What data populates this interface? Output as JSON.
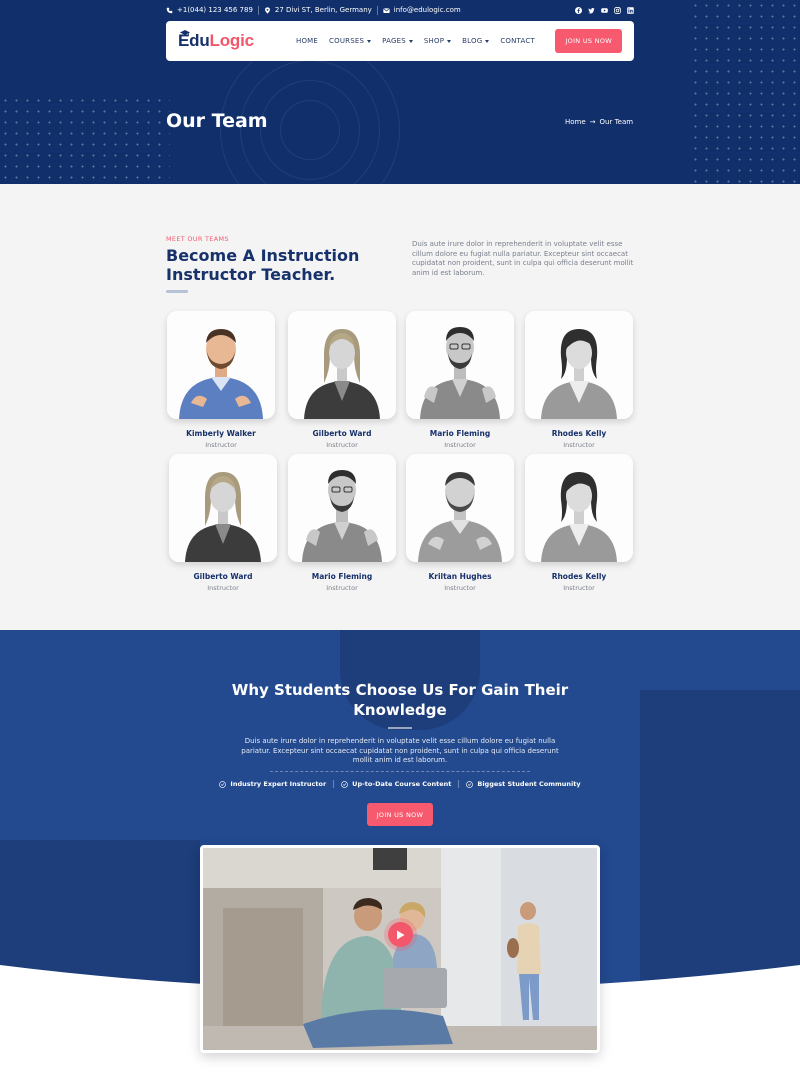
{
  "topbar": {
    "phone": "+1(044) 123 456 789",
    "address": "27 Divi ST, Berlin, Germany",
    "email": "info@edulogic.com",
    "socials": [
      "facebook-icon",
      "twitter-icon",
      "youtube-icon",
      "instagram-icon",
      "linkedin-icon"
    ]
  },
  "nav": {
    "logo_first": "Edu",
    "logo_rest": "Logic",
    "items": [
      {
        "label": "HOME",
        "dropdown": false
      },
      {
        "label": "COURSES",
        "dropdown": true
      },
      {
        "label": "PAGES",
        "dropdown": true
      },
      {
        "label": "SHOP",
        "dropdown": true
      },
      {
        "label": "BLOG",
        "dropdown": true
      },
      {
        "label": "CONTACT",
        "dropdown": false
      }
    ],
    "join_button": "JOIN US NOW"
  },
  "hero": {
    "title": "Our Team",
    "breadcrumb_home": "Home",
    "breadcrumb_arrow": "→",
    "breadcrumb_current": "Our Team"
  },
  "team": {
    "kicker": "MEET OUR TEAMS",
    "heading": "Become A Instruction Instructor Teacher.",
    "description": "Duis aute irure dolor in reprehenderit in voluptate velit esse cillum dolore eu fugiat nulla pariatur. Excepteur sint occaecat cupidatat non proident, sunt in culpa qui officia deserunt mollit anim id est laborum.",
    "members": [
      {
        "name": "Kimberly Walker",
        "role": "Instructor"
      },
      {
        "name": "Gilberto Ward",
        "role": "Instructor"
      },
      {
        "name": "Mario Fleming",
        "role": "Instructor"
      },
      {
        "name": "Rhodes Kelly",
        "role": "Instructor"
      },
      {
        "name": "Gilberto Ward",
        "role": "Instructor"
      },
      {
        "name": "Mario Fleming",
        "role": "Instructor"
      },
      {
        "name": "Kriltan Hughes",
        "role": "Instructor"
      },
      {
        "name": "Rhodes Kelly",
        "role": "Instructor"
      }
    ]
  },
  "why": {
    "title_line1": "Why Students Choose Us For Gain Their",
    "title_line2": "Knowledge",
    "description": "Duis aute irure dolor in reprehenderit in voluptate velit esse cillum dolore eu fugiat nulla pariatur. Excepteur sint occaecat cupidatat non proident, sunt in culpa qui officia deserunt mollit anim id est laborum.",
    "features": [
      "Industry Expert Instructor",
      "Up-to-Date Course Content",
      "Biggest Student Community"
    ],
    "button": "JOIN US NOW"
  },
  "colors": {
    "navy": "#11306b",
    "accent": "#f75a6e",
    "section_blue": "#23498e",
    "light_bg": "#f4f4f4"
  }
}
